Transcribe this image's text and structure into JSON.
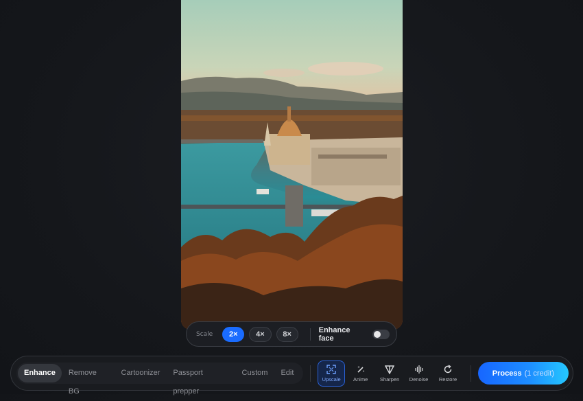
{
  "scale": {
    "label": "Scale",
    "options": [
      "2×",
      "4×",
      "8×"
    ],
    "selected": "2×",
    "enhance_face_label": "Enhance face",
    "enhance_face_on": false
  },
  "modes": {
    "tabs": [
      "Enhance",
      "Remove BG",
      "Cartoonizer",
      "Passport prepper",
      "Custom",
      "Edit"
    ],
    "active": "Enhance"
  },
  "tools": [
    {
      "label": "Upscale",
      "icon": "upscale-icon",
      "active": true
    },
    {
      "label": "Anime",
      "icon": "magic-wand-icon",
      "active": false
    },
    {
      "label": "Sharpen",
      "icon": "sharpen-icon",
      "active": false
    },
    {
      "label": "Denoise",
      "icon": "denoise-icon",
      "active": false
    },
    {
      "label": "Restore",
      "icon": "restore-icon",
      "active": false
    }
  ],
  "process": {
    "label": "Process",
    "cost": "(1 credit)"
  },
  "colors": {
    "accent": "#1a6cff",
    "background": "#15171b"
  }
}
